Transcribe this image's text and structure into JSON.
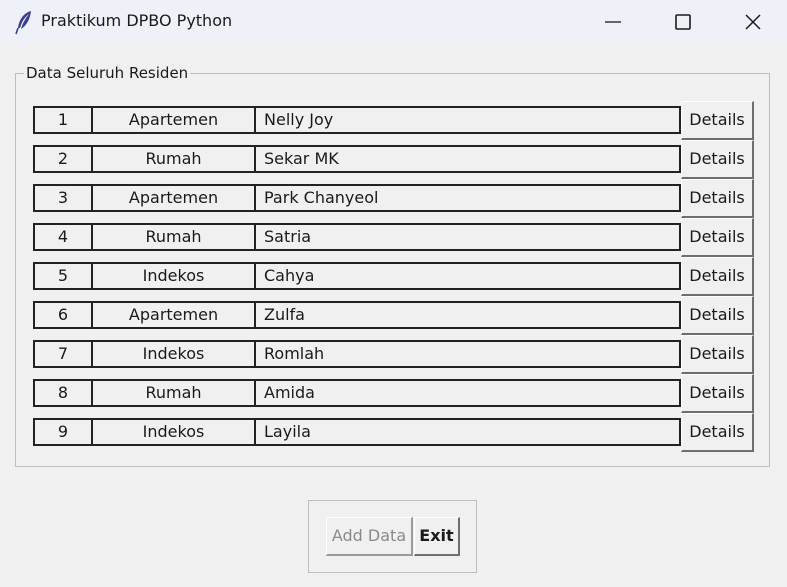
{
  "window": {
    "title": "Praktikum DPBO Python",
    "icon": "feather-icon"
  },
  "group": {
    "label": "Data Seluruh Residen"
  },
  "residents": [
    {
      "id": "1",
      "type": "Apartemen",
      "name": "Nelly Joy",
      "action": "Details"
    },
    {
      "id": "2",
      "type": "Rumah",
      "name": "Sekar MK",
      "action": "Details"
    },
    {
      "id": "3",
      "type": "Apartemen",
      "name": "Park Chanyeol",
      "action": "Details"
    },
    {
      "id": "4",
      "type": "Rumah",
      "name": "Satria",
      "action": "Details"
    },
    {
      "id": "5",
      "type": "Indekos",
      "name": "Cahya",
      "action": "Details"
    },
    {
      "id": "6",
      "type": "Apartemen",
      "name": "Zulfa",
      "action": "Details"
    },
    {
      "id": "7",
      "type": "Indekos",
      "name": "Romlah",
      "action": "Details"
    },
    {
      "id": "8",
      "type": "Rumah",
      "name": "Amida",
      "action": "Details"
    },
    {
      "id": "9",
      "type": "Indekos",
      "name": "Layila",
      "action": "Details"
    }
  ],
  "buttons": {
    "add_label": "Add Data",
    "add_enabled": false,
    "exit_label": "Exit"
  }
}
